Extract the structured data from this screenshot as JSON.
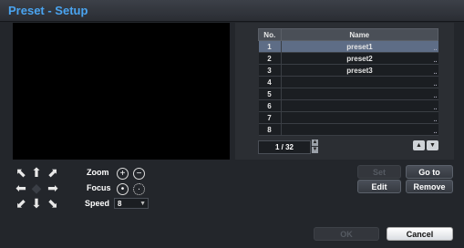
{
  "title": "Preset - Setup",
  "table": {
    "headers": {
      "no": "No.",
      "name": "Name"
    },
    "rows": [
      {
        "no": "1",
        "name": "preset1"
      },
      {
        "no": "2",
        "name": "preset2"
      },
      {
        "no": "3",
        "name": "preset3"
      },
      {
        "no": "4",
        "name": ""
      },
      {
        "no": "5",
        "name": ""
      },
      {
        "no": "6",
        "name": ""
      },
      {
        "no": "7",
        "name": ""
      },
      {
        "no": "8",
        "name": ""
      }
    ],
    "row_edit_glyph": "..",
    "selected_row": 1
  },
  "pagination": {
    "value": "1 / 32"
  },
  "controls": {
    "zoom_label": "Zoom",
    "focus_label": "Focus",
    "speed_label": "Speed",
    "speed_value": "8"
  },
  "buttons": {
    "set": "Set",
    "goto": "Go to",
    "edit": "Edit",
    "remove": "Remove",
    "ok": "OK",
    "cancel": "Cancel"
  },
  "icons": {
    "ptz": [
      "arrow-up-left-icon",
      "arrow-up-icon",
      "arrow-up-right-icon",
      "arrow-left-icon",
      "center-icon",
      "arrow-right-icon",
      "arrow-down-left-icon",
      "arrow-down-icon",
      "arrow-down-right-icon"
    ],
    "zoom_in": "zoom-in-icon",
    "zoom_out": "zoom-out-icon",
    "focus_near": "focus-near-icon",
    "focus_far": "focus-far-icon"
  },
  "colors": {
    "title": "#4aa4f0",
    "selected_row": "#5e6d86"
  }
}
